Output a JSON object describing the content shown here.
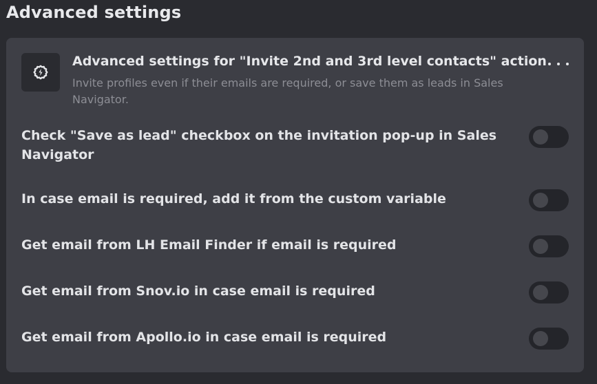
{
  "page": {
    "title": "Advanced settings"
  },
  "card": {
    "icon": "settings-bolt-icon",
    "title": "Advanced settings for \"Invite 2nd and 3rd level contacts\" action",
    "description": "Invite profiles even if their emails are required, or save them as leads in Sales Navigator.",
    "more_icon": "more-horizontal-icon"
  },
  "settings": [
    {
      "label": "Check \"Save as lead\" checkbox on the invitation pop-up in Sales Navigator",
      "enabled": false
    },
    {
      "label": "In case email is required, add it from the custom variable",
      "enabled": false
    },
    {
      "label": "Get email from LH Email Finder if email is required",
      "enabled": false
    },
    {
      "label": "Get email from Snov.io in case email is required",
      "enabled": false
    },
    {
      "label": "Get email from Apollo.io in case email is required",
      "enabled": false
    }
  ],
  "colors": {
    "background": "#2a2b30",
    "card": "#3e3f46",
    "toggle_track_off": "#24252a",
    "toggle_knob_off": "#46474d",
    "muted_text": "#8d8e95"
  }
}
